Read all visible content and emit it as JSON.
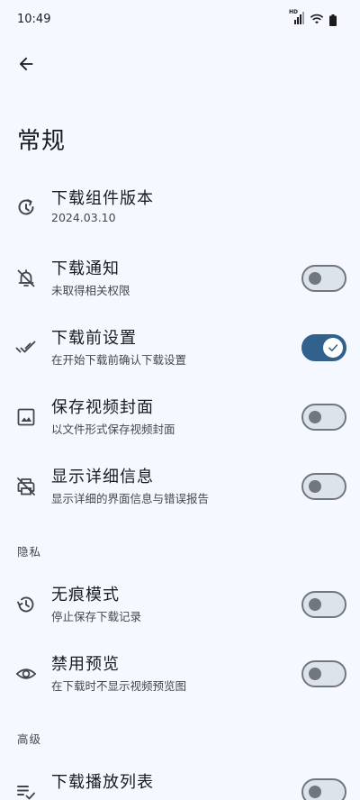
{
  "status_bar": {
    "time": "10:49",
    "network_badge": "HD"
  },
  "header": {
    "title": "常规"
  },
  "settings": [
    {
      "title": "下载组件版本",
      "desc": "2024.03.10",
      "icon": "update-clock-icon"
    },
    {
      "title": "下载通知",
      "desc": "未取得相关权限",
      "icon": "notifications-off-icon",
      "toggle": false
    },
    {
      "title": "下载前设置",
      "desc": "在开始下载前确认下载设置",
      "icon": "done-all-icon",
      "toggle": true
    },
    {
      "title": "保存视频封面",
      "desc": "以文件形式保存视频封面",
      "icon": "image-icon",
      "toggle": false
    },
    {
      "title": "显示详细信息",
      "desc": "显示详细的界面信息与错误报告",
      "icon": "print-disabled-icon",
      "toggle": false
    }
  ],
  "sections": {
    "privacy": "隐私",
    "advanced": "高级"
  },
  "privacy_settings": [
    {
      "title": "无痕模式",
      "desc": "停止保存下载记录",
      "icon": "history-icon",
      "toggle": false
    },
    {
      "title": "禁用预览",
      "desc": "在下载时不显示视频预览图",
      "icon": "eye-icon",
      "toggle": false
    }
  ],
  "advanced_settings": [
    {
      "title": "下载播放列表",
      "icon": "playlist-add-check-icon",
      "toggle": false
    }
  ],
  "colors": {
    "background": "#f5f9ff",
    "accent": "#33618d",
    "outline": "#72777f",
    "track_off": "#dde3ea"
  }
}
